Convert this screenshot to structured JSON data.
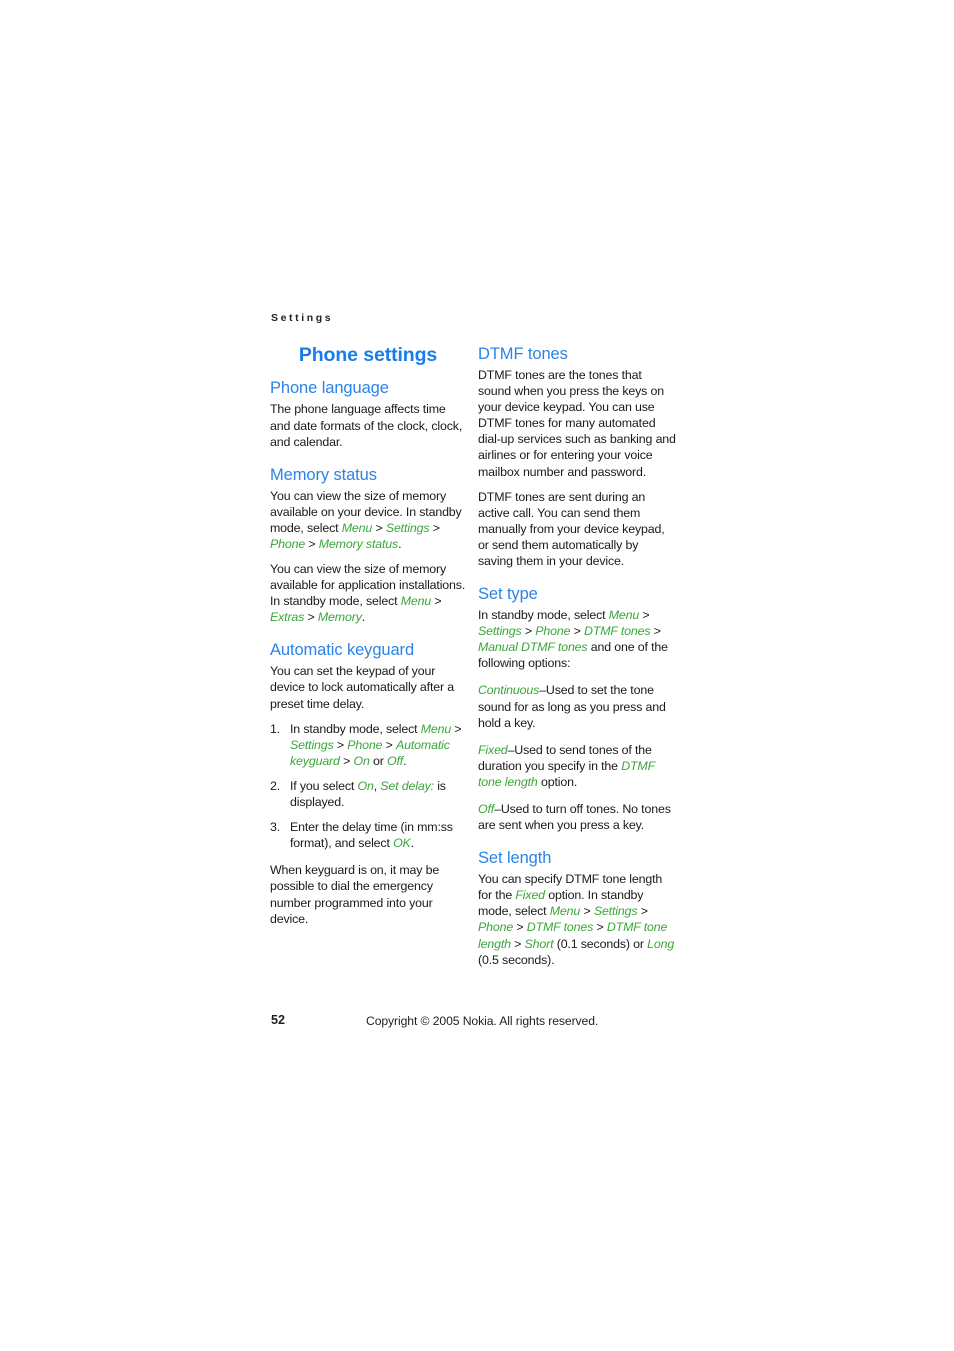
{
  "running_header": "Settings",
  "doc_title": "Phone settings",
  "footer": {
    "page_number": "52",
    "copyright": "Copyright © 2005 Nokia. All rights reserved."
  },
  "left_column": {
    "phone_language": {
      "heading": "Phone language",
      "paragraph": "The phone language affects time and date formats of the clock, clock, and calendar."
    },
    "memory_status": {
      "heading": "Memory status",
      "p1_lead": "You can view the size of memory available on your device. In standby mode, select ",
      "p1_ref1": "Menu",
      "p1_sep1": " > ",
      "p1_ref2": "Settings",
      "p1_sep2": " > ",
      "p1_ref3": "Phone",
      "p1_sep3": " > ",
      "p1_ref4": "Memory status",
      "p1_tail": ".",
      "p2_lead": "You can view the size of memory available for application installations. In standby mode, select ",
      "p2_ref1": "Menu",
      "p2_sep1": " > ",
      "p2_ref2": "Extras",
      "p2_sep2": " > ",
      "p2_ref3": "Memory",
      "p2_tail": "."
    },
    "automatic_keyguard": {
      "heading": "Automatic keyguard",
      "intro": "You can set the keypad of your device to lock automatically after a preset time delay.",
      "step1_lead": "In standby mode, select ",
      "step1_ref1": "Menu",
      "step1_sep1": " > ",
      "step1_ref2": "Settings",
      "step1_sep2": " > ",
      "step1_ref3": "Phone",
      "step1_sep3": " > ",
      "step1_ref4": "Automatic keyguard",
      "step1_sep4": " > ",
      "step1_ref5": "On",
      "step1_mid": " or ",
      "step1_ref6": "Off",
      "step1_tail": ".",
      "step2_lead": "If you select ",
      "step2_ref1": "On",
      "step2_mid": ", ",
      "step2_ref2": "Set delay:",
      "step2_tail": " is displayed.",
      "step3_lead": "Enter the delay time (in mm:ss format), and select ",
      "step3_ref1": "OK",
      "step3_tail": ".",
      "outro": "When keyguard is on, it may be possible to dial the emergency number programmed into your device."
    }
  },
  "right_column": {
    "dtmf_tones": {
      "heading": "DTMF tones",
      "p1": "DTMF tones are the tones that sound when you press the keys on your device keypad. You can use DTMF tones for many automated dial-up services such as banking and airlines or for entering your voice mailbox number and password.",
      "p2": "DTMF tones are sent during an active call. You can send them manually from your device keypad, or send them automatically by saving them in your device."
    },
    "set_type": {
      "heading": "Set type",
      "intro_lead": "In standby mode, select ",
      "intro_ref1": "Menu",
      "intro_sep1": " > ",
      "intro_ref2": "Settings",
      "intro_sep2": " > ",
      "intro_ref3": "Phone",
      "intro_sep3": " > ",
      "intro_ref4": "DTMF tones",
      "intro_sep4": " > ",
      "intro_ref5": "Manual DTMF tones",
      "intro_tail": " and one of the following options:",
      "opt1_ref": "Continuous",
      "opt1_text": "–Used to set the tone sound for as long as you press and hold a key.",
      "opt2_ref": "Fixed",
      "opt2_lead": "–Used to send tones of the duration you specify in the ",
      "opt2_ref2": "DTMF tone length",
      "opt2_tail": " option.",
      "opt3_ref": "Off",
      "opt3_text": "–Used to turn off tones. No tones are sent when you press a key."
    },
    "set_length": {
      "heading": "Set length",
      "p_lead": "You can specify DTMF tone length for the ",
      "p_ref1": "Fixed",
      "p_mid1": " option. In standby mode, select ",
      "p_ref2": "Menu",
      "p_sep1": " > ",
      "p_ref3": "Settings",
      "p_sep2": " > ",
      "p_ref4": "Phone",
      "p_sep3": " > ",
      "p_ref5": "DTMF tones",
      "p_sep4": " > ",
      "p_ref6": "DTMF tone length",
      "p_sep5": " > ",
      "p_ref7": "Short",
      "p_mid2": " (0.1 seconds) or ",
      "p_ref8": "Long",
      "p_tail": " (0.5 seconds)."
    }
  }
}
